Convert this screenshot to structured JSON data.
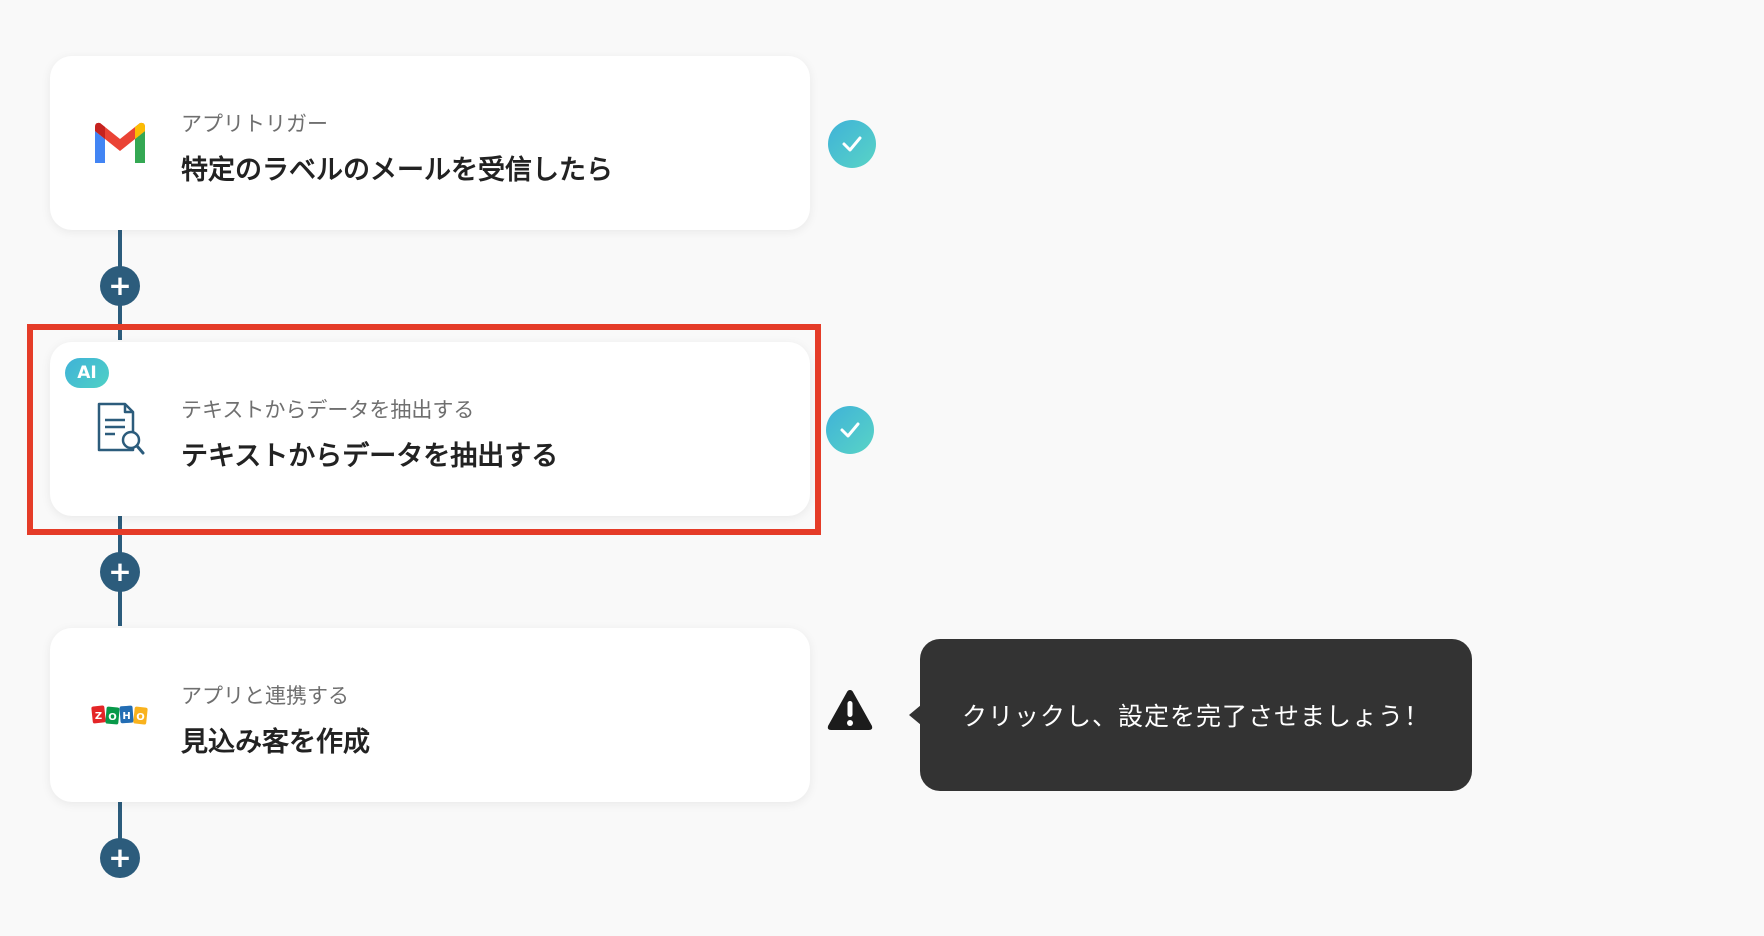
{
  "flow": {
    "steps": [
      {
        "subtitle": "アプリトリガー",
        "title": "特定のラベルのメールを受信したら",
        "icon": "gmail-icon",
        "status": "complete"
      },
      {
        "badge": "AI",
        "subtitle": "テキストからデータを抽出する",
        "title": "テキストからデータを抽出する",
        "icon": "document-search-icon",
        "status": "complete",
        "highlighted": true
      },
      {
        "subtitle": "アプリと連携する",
        "title": "見込み客を作成",
        "icon": "zoho-icon",
        "status": "warning"
      }
    ],
    "add_button_label": "+"
  },
  "tooltip": {
    "text": "クリックし、設定を完了させましょう！"
  },
  "colors": {
    "background": "#f9f9f9",
    "connector": "#2c5c7c",
    "highlight": "#e53c28",
    "check_gradient_start": "#3fb2d8",
    "check_gradient_end": "#59d4c6",
    "tooltip_bg": "#333333"
  }
}
